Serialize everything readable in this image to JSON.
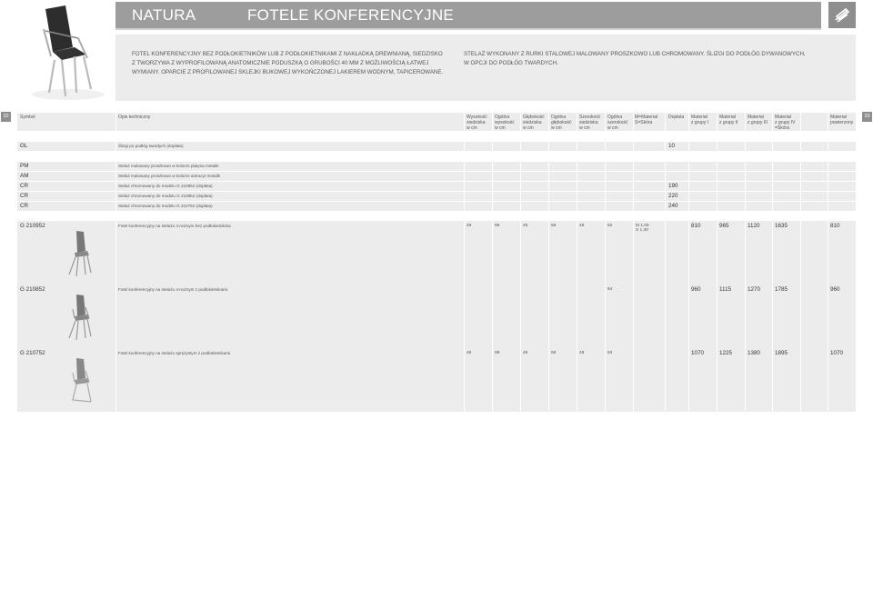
{
  "header": {
    "left_title": "NATURA",
    "right_title": "FOTELE KONFERENCYJNE"
  },
  "description": {
    "left_lines": [
      "FOTEL KONFERENCYJNY BEZ PODŁOKIETNIKÓW LUB Z PODŁOKIETNIKAMI Z NAKŁADKĄ DREWNIANĄ, SIEDZISKO",
      "Z TWORZYWA Z WYPROFILOWANĄ ANATOMICZNIE PODUSZKĄ O GRUBOŚCI 40 MM Z MOŻLIWOŚCIĄ ŁATWEJ",
      "WYMIANY. OPARCIE Z PROFILOWANEJ SKLEJKI BUKOWEJ WYKOŃCZONEJ LAKIEREM WODNYM, TAPICEROWANE."
    ],
    "right_lines": [
      "STELAŻ WYKONANY Z RURKI STALOWEJ MALOWANY PROSZKOWO LUB CHROMOWANY. ŚLIZGI DO PODŁÓG DYWANOWYCH,",
      "W OPCJI DO PODŁÓG TWARDYCH."
    ]
  },
  "pages": {
    "left": "32",
    "right": "33"
  },
  "table": {
    "headers": {
      "symbol": "Symbol",
      "opis": "Opis techniczny",
      "cols": [
        [
          "Wysokość",
          "siedziska",
          "w cm"
        ],
        [
          "Ogólna",
          "wysokość",
          "w cm"
        ],
        [
          "Głębokość",
          "siedziska",
          "w cm"
        ],
        [
          "Ogólna",
          "głębokość",
          "w cm"
        ],
        [
          "Szerokość",
          "siedziska",
          "w cm"
        ],
        [
          "Ogólna",
          "szerokość",
          "w cm"
        ],
        [
          "M=Materiał",
          "S=Skóra",
          ""
        ],
        [
          "Dopłata",
          "",
          ""
        ],
        [
          "Materiał",
          "z grupy I",
          ""
        ],
        [
          "Materiał",
          "z grupy II",
          ""
        ],
        [
          "Materiał",
          "z grupy III",
          ""
        ],
        [
          "Materiał",
          "z grupy IV",
          "=Skóra"
        ],
        [
          "Materiał",
          "powierzony",
          ""
        ]
      ]
    },
    "options_gl": {
      "symbol": "GL",
      "desc": "Ślizgi po podłóg twardych (dopłata)",
      "doplata": "10"
    },
    "frames": [
      {
        "symbol": "PM",
        "desc": "Stelaż malowany proszkowo w kolorze platyna metalik",
        "doplata": ""
      },
      {
        "symbol": "AM",
        "desc": "Stelaż malowany proszkowo w kolorze antracyt metalik",
        "doplata": ""
      },
      {
        "symbol": "CR",
        "desc": "Stelaż chromowany do modelu G 210952 (dopłata)",
        "doplata": "190"
      },
      {
        "symbol": "CR",
        "desc": "Stelaż chromowany do modelu G 210852 (dopłata)",
        "doplata": "220"
      },
      {
        "symbol": "CR",
        "desc": "Stelaż chromowany do modelu G 210752 (dopłata)",
        "doplata": "240"
      }
    ],
    "products": [
      {
        "symbol": "G 210952",
        "desc": "Fotel konferencyjny na stelażu 4-nożnym bez podłokietników.",
        "wys_s": "49",
        "wys": "98",
        "gl_s": "45",
        "gl": "58",
        "sz_s": "48",
        "sz": "62",
        "ms": [
          "M 1,05",
          "S 1,30"
        ],
        "g1": "810",
        "g2": "965",
        "g3": "1120",
        "g4": "1635",
        "pow": "810"
      },
      {
        "symbol": "G 210852",
        "desc": "Fotel konferencyjny na stelażu 4-nożnym z podłokietnikami.",
        "wys_s": "",
        "wys": "",
        "gl_s": "",
        "gl": "",
        "sz_s": "",
        "sz": "64",
        "ms": [
          "",
          ""
        ],
        "g1": "960",
        "g2": "1115",
        "g3": "1270",
        "g4": "1785",
        "pow": "960"
      },
      {
        "symbol": "G 210752",
        "desc": "Fotel konferencyjny na stelażu sprężystym z podłokietnikami.",
        "wys_s": "48",
        "wys": "98",
        "gl_s": "45",
        "gl": "58",
        "sz_s": "48",
        "sz": "63",
        "ms": [
          "",
          ""
        ],
        "g1": "1070",
        "g2": "1225",
        "g3": "1380",
        "g4": "1895",
        "pow": "1070"
      }
    ]
  },
  "colors": {
    "header_bg": "#9d9d9d",
    "panel_bg": "#ececec",
    "badge_bg": "#8e8e8e"
  },
  "icons": {
    "logo": "s-logo-icon",
    "chair": "chair-icon"
  }
}
